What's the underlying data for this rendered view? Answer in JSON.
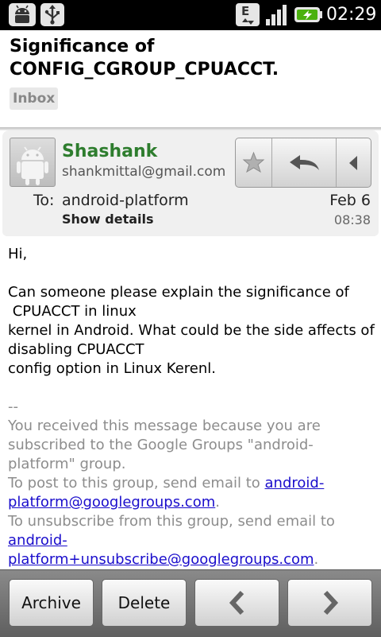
{
  "status_bar": {
    "time": "02:29",
    "icons": [
      "android-debug-icon",
      "usb-icon",
      "edge-data-icon",
      "signal-icon",
      "battery-charging-icon"
    ]
  },
  "subject": {
    "title": "Significance of CONFIG_CGROUP_CPUACCT.",
    "label": "Inbox"
  },
  "message": {
    "sender_name": "Shashank",
    "sender_email": "shankmittal@gmail.com",
    "to_label": "To:",
    "to_value": "android-platform",
    "show_details": "Show details",
    "date": "Feb 6",
    "time": "08:38",
    "actions": [
      "star-icon",
      "reply-icon",
      "more-icon"
    ]
  },
  "body": {
    "greeting": "Hi,",
    "line1": "Can someone please explain the significance of",
    "line2": " CPUACCT in linux",
    "line3": "kernel in Android. What could be the side affects of disabling CPUACCT",
    "line4": "config option in Linux Kerenl.",
    "sig_dash": "--",
    "footer1": "You received this message because you are subscribed to the Google Groups \"android-platform\" group.",
    "footer2_prefix": "To post to this group, send email to ",
    "footer2_link": "android-platform@googlegroups.com",
    "footer2_suffix": ".",
    "footer3_prefix": "To unsubscribe from this group, send email to ",
    "footer3_link": "android-platform+unsubscribe@googlegroups.com",
    "footer3_suffix": "."
  },
  "toolbar": {
    "archive_label": "Archive",
    "delete_label": "Delete",
    "prev_icon": "chevron-left-icon",
    "next_icon": "chevron-right-icon"
  }
}
